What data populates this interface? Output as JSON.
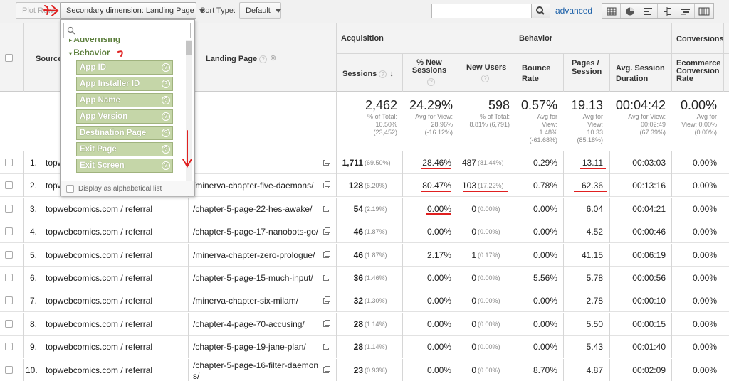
{
  "toolbar": {
    "plot_rows": "Plot Rows",
    "secondary_dimension": "Secondary dimension: Landing Page",
    "sort_type_label": "Sort Type:",
    "sort_type_value": "Default",
    "search_placeholder": "",
    "advanced": "advanced",
    "view_icons": [
      "table-view-icon",
      "pie-view-icon",
      "bar-view-icon",
      "comparison-view-icon",
      "term-cloud-icon",
      "pivot-view-icon"
    ]
  },
  "header": {
    "source": "Source",
    "landing_page": "Landing Page",
    "groups": {
      "acquisition": "Acquisition",
      "behavior": "Behavior",
      "conversions": "Conversions"
    },
    "columns": {
      "sessions": "Sessions",
      "new_sessions": "% New Sessions",
      "new_users": "New Users",
      "bounce_rate": "Bounce Rate",
      "pages_session": "Pages / Session",
      "avg_duration": "Avg. Session Duration",
      "ecommerce": "Ecommerce Conversion Rate"
    }
  },
  "totals": {
    "sessions": {
      "value": "2,462",
      "sub1": "% of Total:",
      "sub2": "10.50%",
      "sub3": "(23,452)"
    },
    "new_sessions": {
      "value": "24.29%",
      "sub1": "Avg for View:",
      "sub2": "28.96%",
      "sub3": "(-16.12%)"
    },
    "new_users": {
      "value": "598",
      "sub1": "% of Total:",
      "sub2": "8.81% (6,791)"
    },
    "bounce_rate": {
      "value": "0.57%",
      "sub1": "Avg for",
      "sub2": "View:",
      "sub3": "1.48%",
      "sub4": "(-61.68%)"
    },
    "pages_session": {
      "value": "19.13",
      "sub1": "Avg for",
      "sub2": "View:",
      "sub3": "10.33",
      "sub4": "(85.18%)"
    },
    "avg_duration": {
      "value": "00:04:42",
      "sub1": "Avg for View:",
      "sub2": "00:02:49",
      "sub3": "(67.39%)"
    },
    "ecommerce": {
      "value": "0.00%",
      "sub1": "Avg for",
      "sub2": "View: 0.00%",
      "sub3": "(0.00%)"
    }
  },
  "rows": [
    {
      "n": "1.",
      "source": "topw",
      "landing": "",
      "sessions": "1,711",
      "sessions_pct": "(69.50%)",
      "new_sessions": "28.46%",
      "new_users": "487",
      "new_users_pct": "(81.44%)",
      "bounce": "0.29%",
      "pages": "13.11",
      "duration": "00:03:03",
      "ecom": "0.00%"
    },
    {
      "n": "2.",
      "source": "topw",
      "landing": "/minerva-chapter-five-daemons/",
      "sessions": "128",
      "sessions_pct": "(5.20%)",
      "new_sessions": "80.47%",
      "new_users": "103",
      "new_users_pct": "(17.22%)",
      "bounce": "0.78%",
      "pages": "62.36",
      "duration": "00:13:16",
      "ecom": "0.00%"
    },
    {
      "n": "3.",
      "source": "topwebcomics.com / referral",
      "landing": "/chapter-5-page-22-hes-awake/",
      "sessions": "54",
      "sessions_pct": "(2.19%)",
      "new_sessions": "0.00%",
      "new_users": "0",
      "new_users_pct": "(0.00%)",
      "bounce": "0.00%",
      "pages": "6.04",
      "duration": "00:04:21",
      "ecom": "0.00%"
    },
    {
      "n": "4.",
      "source": "topwebcomics.com / referral",
      "landing": "/chapter-5-page-17-nanobots-go/",
      "sessions": "46",
      "sessions_pct": "(1.87%)",
      "new_sessions": "0.00%",
      "new_users": "0",
      "new_users_pct": "(0.00%)",
      "bounce": "0.00%",
      "pages": "4.52",
      "duration": "00:00:46",
      "ecom": "0.00%"
    },
    {
      "n": "5.",
      "source": "topwebcomics.com / referral",
      "landing": "/minerva-chapter-zero-prologue/",
      "sessions": "46",
      "sessions_pct": "(1.87%)",
      "new_sessions": "2.17%",
      "new_users": "1",
      "new_users_pct": "(0.17%)",
      "bounce": "0.00%",
      "pages": "41.15",
      "duration": "00:06:19",
      "ecom": "0.00%"
    },
    {
      "n": "6.",
      "source": "topwebcomics.com / referral",
      "landing": "/chapter-5-page-15-much-input/",
      "sessions": "36",
      "sessions_pct": "(1.46%)",
      "new_sessions": "0.00%",
      "new_users": "0",
      "new_users_pct": "(0.00%)",
      "bounce": "5.56%",
      "pages": "5.78",
      "duration": "00:00:56",
      "ecom": "0.00%"
    },
    {
      "n": "7.",
      "source": "topwebcomics.com / referral",
      "landing": "/minerva-chapter-six-milam/",
      "sessions": "32",
      "sessions_pct": "(1.30%)",
      "new_sessions": "0.00%",
      "new_users": "0",
      "new_users_pct": "(0.00%)",
      "bounce": "0.00%",
      "pages": "2.78",
      "duration": "00:00:10",
      "ecom": "0.00%"
    },
    {
      "n": "8.",
      "source": "topwebcomics.com / referral",
      "landing": "/chapter-4-page-70-accusing/",
      "sessions": "28",
      "sessions_pct": "(1.14%)",
      "new_sessions": "0.00%",
      "new_users": "0",
      "new_users_pct": "(0.00%)",
      "bounce": "0.00%",
      "pages": "5.50",
      "duration": "00:00:15",
      "ecom": "0.00%"
    },
    {
      "n": "9.",
      "source": "topwebcomics.com / referral",
      "landing": "/chapter-5-page-19-jane-plan/",
      "sessions": "28",
      "sessions_pct": "(1.14%)",
      "new_sessions": "0.00%",
      "new_users": "0",
      "new_users_pct": "(0.00%)",
      "bounce": "0.00%",
      "pages": "5.43",
      "duration": "00:01:40",
      "ecom": "0.00%"
    },
    {
      "n": "10.",
      "source": "topwebcomics.com / referral",
      "landing": "/chapter-5-page-16-filter-daemon",
      "landing2": "s/",
      "sessions": "23",
      "sessions_pct": "(0.93%)",
      "new_sessions": "0.00%",
      "new_users": "0",
      "new_users_pct": "(0.00%)",
      "bounce": "8.70%",
      "pages": "4.87",
      "duration": "00:02:09",
      "ecom": "0.00%"
    }
  ],
  "dropdown": {
    "search_value": "",
    "category_partial": "Advertising",
    "category": "Behavior",
    "items": [
      "App ID",
      "App Installer ID",
      "App Name",
      "App Version",
      "Destination Page",
      "Exit Page",
      "Exit Screen"
    ],
    "footer": "Display as alphabetical list"
  },
  "colors": {
    "annotation": "#e02020",
    "link": "#1a5fa8",
    "dropdown_item": "#c5d6a8",
    "category": "#5a7d3a"
  }
}
